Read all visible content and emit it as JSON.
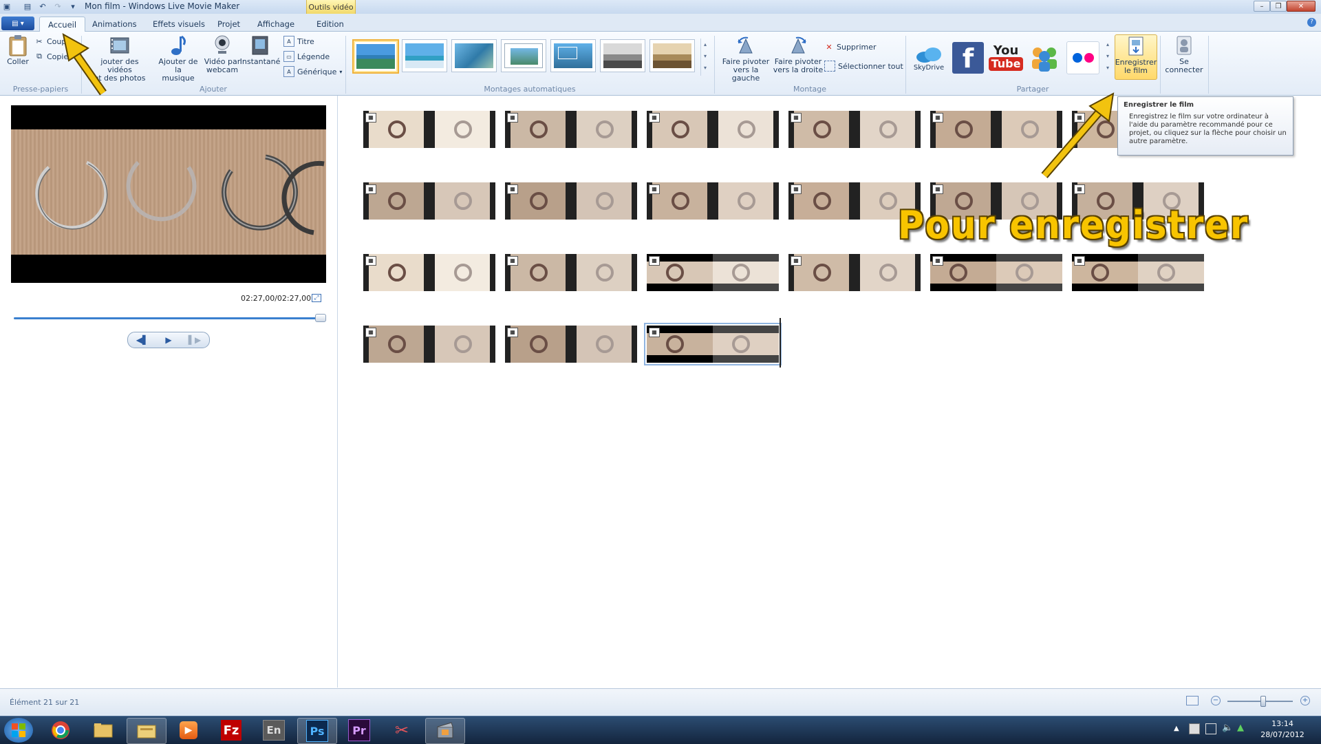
{
  "window": {
    "title": "Mon film - Windows Live Movie Maker",
    "contextual_tab": "Outils vidéo"
  },
  "tabs": [
    {
      "label": "Accueil",
      "active": true
    },
    {
      "label": "Animations"
    },
    {
      "label": "Effets visuels"
    },
    {
      "label": "Projet"
    },
    {
      "label": "Affichage"
    },
    {
      "label": "Edition"
    }
  ],
  "ribbon": {
    "clipboard": {
      "paste": "Coller",
      "cut": "Coup",
      "copy": "Copie",
      "group": "Presse-papiers"
    },
    "add": {
      "add_videos_l1": "jouter des vidéos",
      "add_videos_l2": "et des photos",
      "add_music_l1": "Ajouter de la",
      "add_music_l2": "musique",
      "webcam_l1": "Vidéo par",
      "webcam_l2": "webcam",
      "snapshot": "Instantané",
      "title": "Titre",
      "caption": "Légende",
      "credits": "Générique",
      "group": "Ajouter"
    },
    "automovie": {
      "group": "Montages automatiques"
    },
    "editing": {
      "rotate_left_l1": "Faire pivoter",
      "rotate_left_l2": "vers la gauche",
      "rotate_right_l1": "Faire pivoter",
      "rotate_right_l2": "vers la droite",
      "delete": "Supprimer",
      "select_all": "Sélectionner tout",
      "group": "Montage"
    },
    "share": {
      "skydrive": "SkyDrive",
      "save_movie_l1": "Enregistrer",
      "save_movie_l2": "le film",
      "sign_in_l1": "Se",
      "sign_in_l2": "connecter",
      "group": "Partager"
    }
  },
  "tooltip": {
    "title": "Enregistrer le film",
    "body": "Enregistrez le film sur votre ordinateur à l'aide du paramètre recommandé pour ce projet, ou cliquez sur la flèche pour choisir un autre paramètre."
  },
  "annotation": "Pour enregistrer",
  "preview": {
    "timecode": "02:27,00/02:27,00"
  },
  "statusbar": {
    "text": "Élément 21 sur 21"
  },
  "taskbar": {
    "apps": [
      "En",
      "Ps",
      "Pr",
      "Fz"
    ],
    "time": "13:14",
    "date": "28/07/2012"
  },
  "colors": {
    "accent": "#3a80cf",
    "annotation": "#f8c400",
    "arrow": "#f2c30f"
  }
}
